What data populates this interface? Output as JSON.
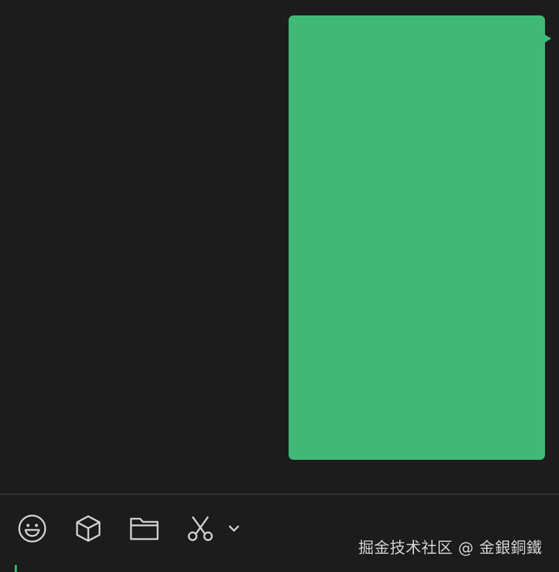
{
  "chat": {
    "bubble_color": "#40b976",
    "background_color": "#1c1c1d"
  },
  "toolbar": {
    "icons": [
      "emoji-icon",
      "box-icon",
      "folder-icon",
      "scissors-icon",
      "chevron-down-icon"
    ],
    "icon_color": "#d2d2d2"
  },
  "watermark": {
    "text": "掘金技术社区 @ 金銀銅鐵"
  },
  "input": {
    "cursor_color": "#2fbf62"
  }
}
